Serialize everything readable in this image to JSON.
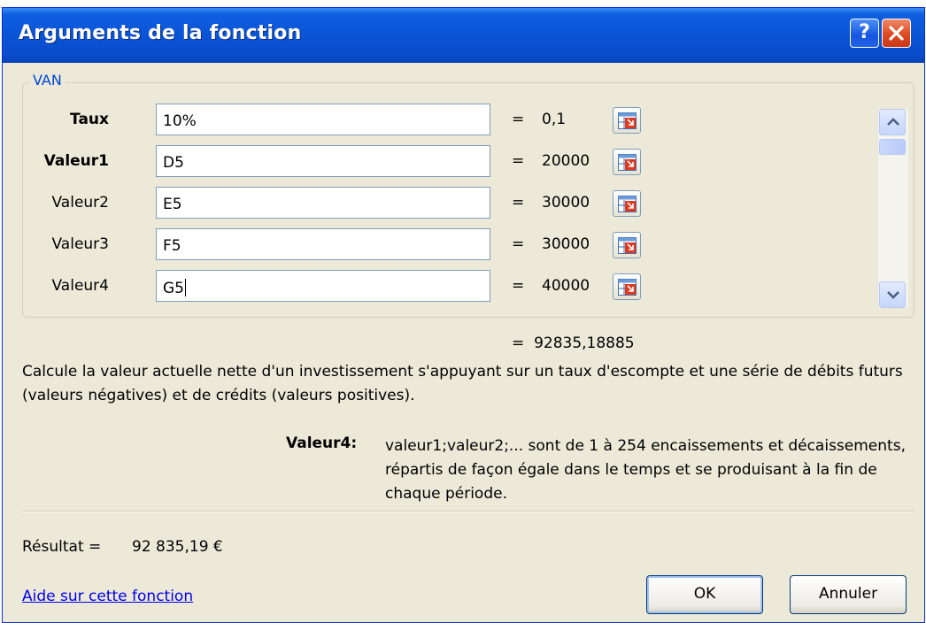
{
  "window": {
    "title": "Arguments de la fonction",
    "help_symbol": "?"
  },
  "function": {
    "name": "VAN",
    "arguments": [
      {
        "label": "Taux",
        "bold": true,
        "value": "10%",
        "result": "0,1"
      },
      {
        "label": "Valeur1",
        "bold": true,
        "value": "D5",
        "result": "20000"
      },
      {
        "label": "Valeur2",
        "bold": false,
        "value": "E5",
        "result": "30000"
      },
      {
        "label": "Valeur3",
        "bold": false,
        "value": "F5",
        "result": "30000"
      },
      {
        "label": "Valeur4",
        "bold": false,
        "value": "G5",
        "result": "40000"
      }
    ],
    "equals_sign": "=",
    "formula_result": "92835,18885",
    "description": "Calcule la valeur actuelle nette d'un investissement s'appuyant sur un taux d'escompte et une série de débits futurs (valeurs négatives) et de crédits (valeurs positives).",
    "active_argument_name": "Valeur4:",
    "active_argument_help": "valeur1;valeur2;... sont de 1 à 254 encaissements et décaissements, répartis de façon égale dans le temps et se produisant à la fin de chaque période."
  },
  "footer": {
    "result_label": "Résultat =",
    "result_value": "92 835,19 €",
    "help_link": "Aide sur cette fonction",
    "ok_label": "OK",
    "cancel_label": "Annuler"
  },
  "colors": {
    "titlebar": "#0a54d6",
    "dialog_bg": "#ece9d8",
    "link": "#0000ee",
    "close_button": "#dc4a22"
  },
  "icons": [
    "help-icon",
    "close-icon",
    "range-selector-icon",
    "scroll-up-icon",
    "scroll-down-icon"
  ]
}
